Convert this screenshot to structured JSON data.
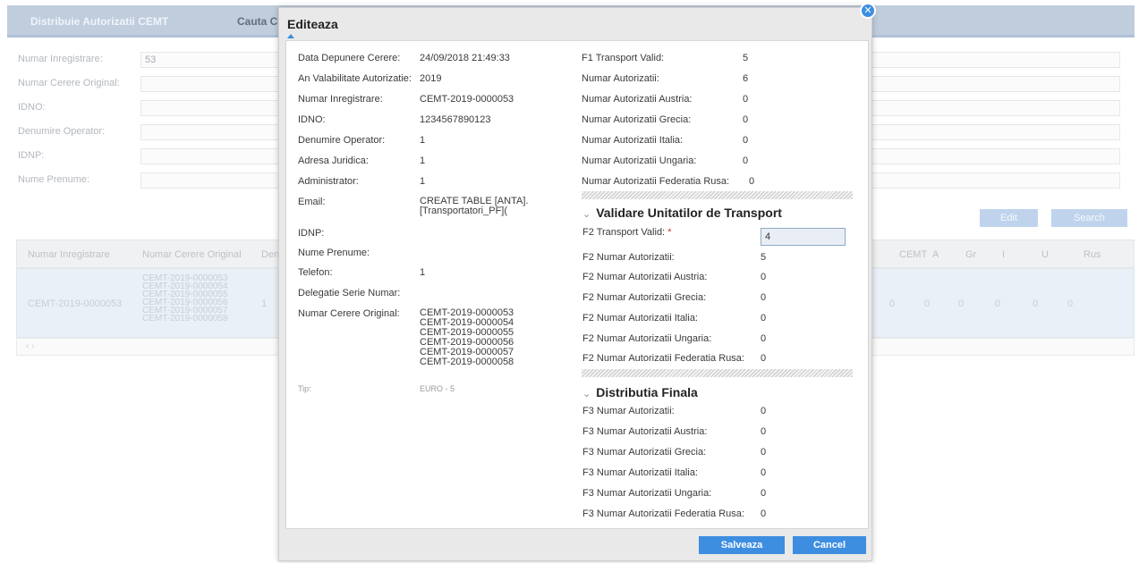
{
  "background": {
    "tabs": [
      "Distribuie Autorizatii CEMT",
      "Cauta Cer"
    ],
    "filters": [
      {
        "label": "Numar Inregistrare:",
        "value": "53"
      },
      {
        "label": "Numar Cerere Original:",
        "value": ""
      },
      {
        "label": "IDNO:",
        "value": ""
      },
      {
        "label": "Denumire Operator:",
        "value": ""
      },
      {
        "label": "IDNP:",
        "value": ""
      },
      {
        "label": "Nume Prenume:",
        "value": ""
      }
    ],
    "buttons": {
      "edit": "Edit",
      "search": "Search"
    },
    "grid": {
      "columns": [
        "Numar Inregistrare",
        "Numar Cerere Original",
        "Den",
        "CEMT",
        "A",
        "Gr",
        "I",
        "U",
        "Rus"
      ],
      "row": {
        "numar_inregistrare": "CEMT-2019-0000053",
        "cereri": "CEMT-2019-0000053\nCEMT-2019-0000054\nCEMT-2019-0000055\nCEMT-2019-0000056\nCEMT-2019-0000057\nCEMT-2019-0000058",
        "den": "1",
        "cemt": "0",
        "a": "0",
        "gr": "0",
        "i": "0",
        "u": "0",
        "rus": "0"
      },
      "pager": "‹  ›"
    }
  },
  "modal": {
    "title": "Editeaza",
    "close_icon": "close-icon",
    "left": [
      {
        "label": "Data Depunere Cerere:",
        "value": "24/09/2018 21:49:33"
      },
      {
        "label": "An Valabilitate Autorizatie:",
        "value": "2019"
      },
      {
        "label": "Numar Inregistrare:",
        "value": "CEMT-2019-0000053"
      },
      {
        "label": "IDNO:",
        "value": "1234567890123"
      },
      {
        "label": "Denumire Operator:",
        "value": "1"
      },
      {
        "label": "Adresa Juridica:",
        "value": "1"
      },
      {
        "label": "Administrator:",
        "value": "1"
      },
      {
        "label": "Email:",
        "value": "CREATE TABLE [ANTA].\n[Transportatori_PF]("
      },
      {
        "label": "IDNP:",
        "value": ""
      },
      {
        "label": "Nume Prenume:",
        "value": ""
      },
      {
        "label": "Telefon:",
        "value": "1"
      },
      {
        "label": "Delegatie Serie Numar:",
        "value": ""
      },
      {
        "label": "Numar Cerere Original:",
        "value": "CEMT-2019-0000053\nCEMT-2019-0000054\nCEMT-2019-0000055\nCEMT-2019-0000056\nCEMT-2019-0000057\nCEMT-2019-0000058"
      },
      {
        "label": "Tip:",
        "value": "EURO - 5"
      }
    ],
    "f1": [
      {
        "label": "F1 Transport Valid:",
        "value": "5"
      },
      {
        "label": "Numar Autorizatii:",
        "value": "6"
      },
      {
        "label": "Numar Autorizatii Austria:",
        "value": "0"
      },
      {
        "label": "Numar Autorizatii Grecia:",
        "value": "0"
      },
      {
        "label": "Numar Autorizatii Italia:",
        "value": "0"
      },
      {
        "label": "Numar Autorizatii Ungaria:",
        "value": "0"
      },
      {
        "label": "Numar Autorizatii Federatia Rusa:",
        "value": "0"
      }
    ],
    "section2": {
      "title": "Validare Unitatilor de Transport",
      "transport_label": "F2 Transport Valid:",
      "required_mark": "*",
      "transport_value": "4",
      "rows": [
        {
          "label": "F2 Numar Autorizatii:",
          "value": "5"
        },
        {
          "label": "F2 Numar Autorizatii Austria:",
          "value": "0"
        },
        {
          "label": "F2 Numar Autorizatii Grecia:",
          "value": "0"
        },
        {
          "label": "F2 Numar Autorizatii Italia:",
          "value": "0"
        },
        {
          "label": "F2 Numar Autorizatii Ungaria:",
          "value": "0"
        },
        {
          "label": "F2 Numar Autorizatii Federatia Rusa:",
          "value": "0"
        }
      ]
    },
    "section3": {
      "title": "Distributia Finala",
      "rows": [
        {
          "label": "F3 Numar Autorizatii:",
          "value": "0"
        },
        {
          "label": "F3 Numar Autorizatii Austria:",
          "value": "0"
        },
        {
          "label": "F3 Numar Autorizatii Grecia:",
          "value": "0"
        },
        {
          "label": "F3 Numar Autorizatii Italia:",
          "value": "0"
        },
        {
          "label": "F3 Numar Autorizatii Ungaria:",
          "value": "0"
        },
        {
          "label": "F3 Numar Autorizatii Federatia Rusa:",
          "value": "0"
        }
      ]
    },
    "buttons": {
      "save": "Salveaza",
      "cancel": "Cancel"
    }
  }
}
